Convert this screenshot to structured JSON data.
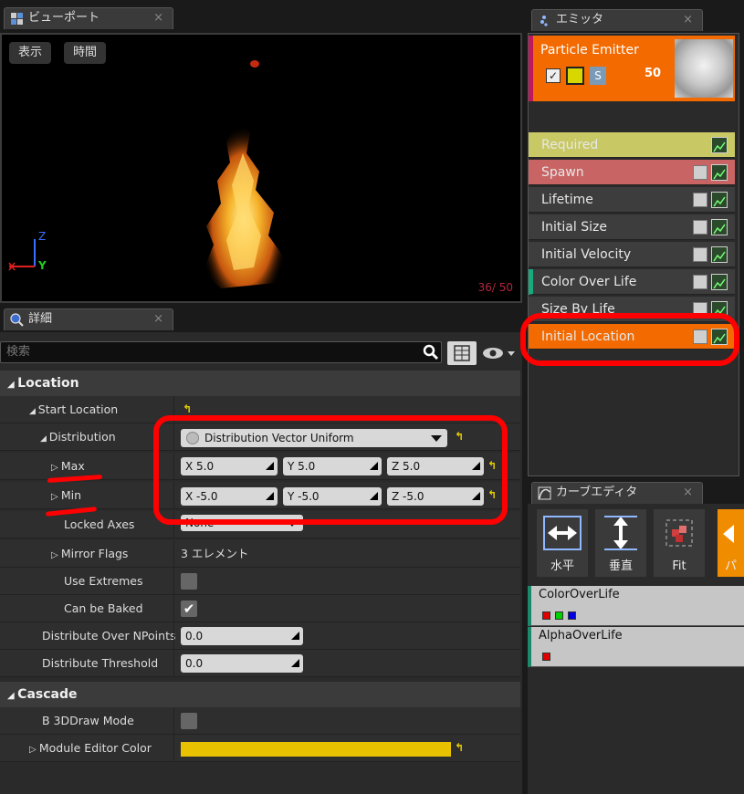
{
  "viewport_tab": {
    "title": "ビューポート",
    "close": "×"
  },
  "viewport": {
    "show_btn": "表示",
    "time_btn": "時間",
    "counter": "36/ 50",
    "axis_z": "Z",
    "axis_y": "Y"
  },
  "details_tab": {
    "title": "詳細",
    "close": "×"
  },
  "details": {
    "search_placeholder": "検索",
    "location_section": "Location",
    "rows": {
      "start_location": "Start Location",
      "distribution": "Distribution",
      "distribution_value": "Distribution Vector Uniform",
      "max": "Max",
      "max_x": "X  5.0",
      "max_y": "Y  5.0",
      "max_z": "Z  5.0",
      "min": "Min",
      "min_x": "X  -5.0",
      "min_y": "Y  -5.0",
      "min_z": "Z  -5.0",
      "locked_axes": "Locked Axes",
      "locked_axes_value": "None",
      "mirror_flags": "Mirror Flags",
      "mirror_flags_value": "3 エレメント",
      "use_extremes": "Use Extremes",
      "can_be_baked": "Can be Baked",
      "distribute_over": "Distribute Over NPoints",
      "distribute_over_value": "0.0",
      "distribute_threshold": "Distribute Threshold",
      "distribute_threshold_value": "0.0"
    },
    "cascade_section": "Cascade",
    "cascade_rows": {
      "draw_mode": "B 3DDraw Mode",
      "editor_color": "Module Editor Color",
      "editor_color_hex": "#e8c200"
    }
  },
  "emitter_tab": {
    "title": "エミッタ",
    "close": "×"
  },
  "emitter": {
    "name": "Particle Emitter",
    "count": "50",
    "s_label": "S",
    "modules": [
      "Required",
      "Spawn",
      "Lifetime",
      "Initial Size",
      "Initial Velocity",
      "Color Over Life",
      "Size By Life",
      "Initial Location"
    ]
  },
  "curve_tab": {
    "title": "カーブエディタ",
    "close": "×"
  },
  "curve": {
    "buttons": [
      "水平",
      "垂直",
      "Fit",
      "パ"
    ],
    "curves": [
      "ColorOverLife",
      "AlphaOverLife"
    ]
  },
  "colors": {
    "accent_orange": "#f26a00",
    "annotation_red": "#ff0000",
    "reset_yellow": "#e8d000"
  }
}
